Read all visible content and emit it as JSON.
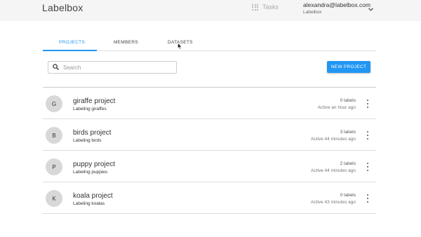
{
  "app": {
    "logo": "Labelbox"
  },
  "header": {
    "tasks_label": "Tasks",
    "tasks_icon": "apps-grid-icon",
    "account_email": "alexandra@labelbox.com",
    "account_org": "Labelbox"
  },
  "tabs": [
    {
      "label": "PROJECTS",
      "active": true
    },
    {
      "label": "MEMBERS",
      "active": false
    },
    {
      "label": "DATASETS",
      "active": false
    }
  ],
  "search": {
    "placeholder": "Search",
    "value": ""
  },
  "new_project_label": "NEW PROJECT",
  "colors": {
    "accent": "#2196f3",
    "avatar_bg": "#d8d8d8"
  },
  "projects": [
    {
      "initial": "G",
      "name": "giraffe project",
      "description": "Labeling giraffes",
      "labels": "0 labels",
      "active": "Active an hour ago"
    },
    {
      "initial": "B",
      "name": "birds project",
      "description": "Labeling birds",
      "labels": "3 labels",
      "active": "Active 44 minutes ago"
    },
    {
      "initial": "P",
      "name": "puppy project",
      "description": "Labeling puppies",
      "labels": "2 labels",
      "active": "Active 44 minutes ago"
    },
    {
      "initial": "K",
      "name": "koala project",
      "description": "Labeling koalas",
      "labels": "0 labels",
      "active": "Active 43 minutes ago"
    }
  ]
}
